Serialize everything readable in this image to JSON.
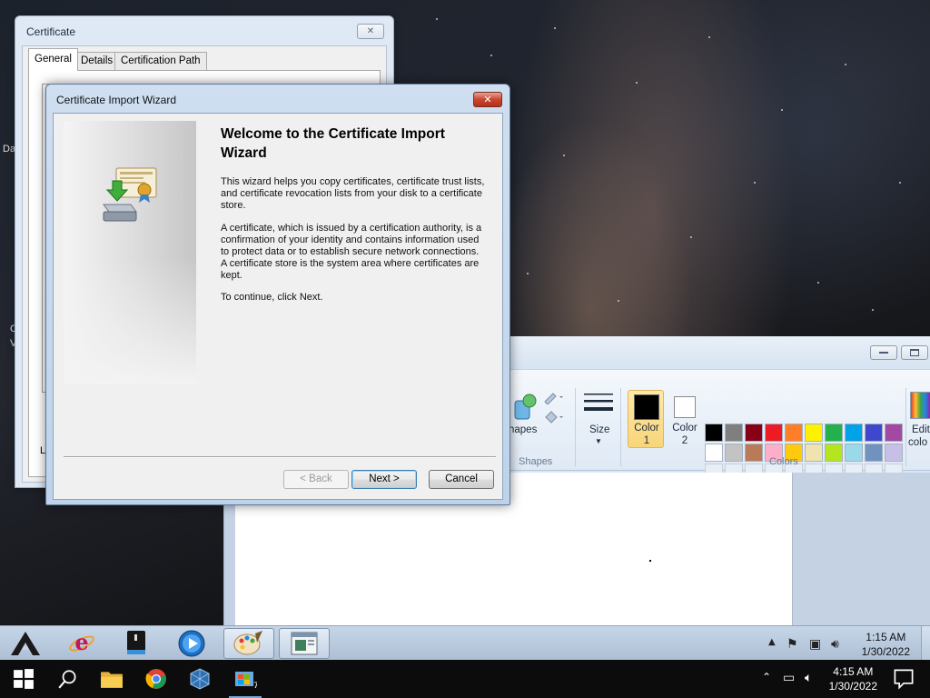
{
  "certificate_window": {
    "title": "Certificate",
    "close_glyph": "✕",
    "tabs": [
      {
        "label": "General",
        "selected": true
      },
      {
        "label": "Details",
        "selected": false
      },
      {
        "label": "Certification Path",
        "selected": false
      }
    ],
    "fragment_text": "Le"
  },
  "wizard": {
    "title": "Certificate Import Wizard",
    "close_glyph": "✕",
    "heading": "Welcome to the Certificate Import Wizard",
    "paragraphs": [
      "This wizard helps you copy certificates, certificate trust lists, and certificate revocation lists from your disk to a certificate store.",
      "A certificate, which is issued by a certification authority, is a confirmation of your identity and contains information used to protect data or to establish secure network connections. A certificate store is the system area where certificates are kept.",
      "To continue, click Next."
    ],
    "buttons": {
      "back": "< Back",
      "next": "Next >",
      "cancel": "Cancel"
    },
    "icon": "certificate-install-icon"
  },
  "paint": {
    "ribbon": {
      "shapes_label": "hapes",
      "shapes_group": "Shapes",
      "size_label": "Size",
      "color1_label": "Color",
      "color1_num": "1",
      "color2_label": "Color",
      "color2_num": "2",
      "colors_group": "Colors",
      "edit_colors_1": "Edit",
      "edit_colors_2": "colo"
    },
    "palette": [
      "#000000",
      "#7f7f7f",
      "#880015",
      "#ed1c24",
      "#ff7f27",
      "#fff200",
      "#22b14c",
      "#00a2e8",
      "#3f48cc",
      "#a349a4",
      "#ffffff",
      "#c3c3c3",
      "#b97a57",
      "#ffaec9",
      "#ffc90e",
      "#efe4b0",
      "#b5e61d",
      "#99d9ea",
      "#7092be",
      "#c8bfe7"
    ],
    "color1": "#000000",
    "color2": "#ffffff"
  },
  "vm_taskbar": {
    "time": "1:15 AM",
    "date": "1/30/2022",
    "items": [
      "adobe-a-icon",
      "internet-explorer-icon",
      "drive-icon",
      "media-player-icon",
      "paint-icon",
      "certificate-window-icon"
    ]
  },
  "host_taskbar": {
    "time": "4:15 AM",
    "date": "1/30/2022",
    "items": [
      "windows-start-icon",
      "search-icon",
      "file-explorer-icon",
      "chrome-icon",
      "virtualbox-icon",
      "vm-windows7-icon"
    ]
  },
  "desktop_fragments": [
    "Da",
    "C",
    "V"
  ]
}
